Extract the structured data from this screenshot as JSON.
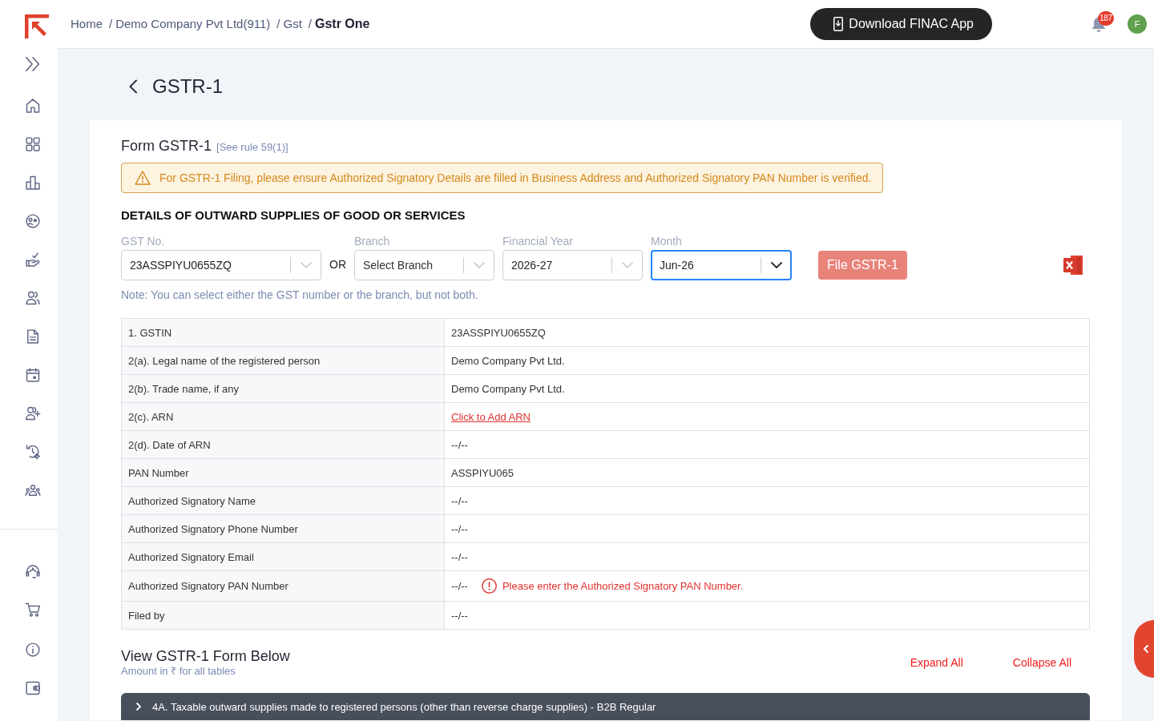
{
  "header": {
    "breadcrumb": [
      {
        "label": "Home",
        "current": false
      },
      {
        "separator": "/",
        "label": "Demo Company Pvt Ltd(911)",
        "current": false
      },
      {
        "separator": "/",
        "label": "Gst",
        "current": false
      },
      {
        "separator": "/",
        "label": "Gstr One",
        "current": true
      }
    ],
    "download_button": "Download FINAC App",
    "notification_count": "187",
    "avatar_initial": "F"
  },
  "page": {
    "title": "GSTR-1"
  },
  "form": {
    "title": "Form GSTR-1",
    "rule": "[See rule 59(1)]",
    "alert": "For GSTR-1 Filing, please ensure Authorized Signatory Details are filled in Business Address and Authorized Signatory PAN Number is verified.",
    "section_heading": "DETAILS OF OUTWARD SUPPLIES OF GOOD OR SERVICES",
    "filters": [
      {
        "kind": "select",
        "label": "GST No.",
        "value": "23ASSPIYU0655ZQ",
        "focused": false
      },
      {
        "kind": "or",
        "text": "OR"
      },
      {
        "kind": "select",
        "label": "Branch",
        "placeholder": "Select Branch",
        "focused": false
      },
      {
        "kind": "select",
        "label": "Financial Year",
        "value": "2026-27",
        "focused": false
      },
      {
        "kind": "select",
        "label": "Month",
        "value": "Jun-26",
        "focused": true
      }
    ],
    "file_button": {
      "label": "File GSTR-1",
      "disabled": true
    },
    "note": "Note: You can select either the GST number or the branch, but not both.",
    "details": [
      {
        "kind": "text",
        "label": "1. GSTIN",
        "value": "23ASSPIYU0655ZQ"
      },
      {
        "kind": "text",
        "label": "2(a). Legal name of the registered person",
        "value": "Demo Company Pvt Ltd."
      },
      {
        "kind": "text",
        "label": "2(b). Trade name, if any",
        "value": "Demo Company Pvt Ltd."
      },
      {
        "kind": "link",
        "label": "2(c). ARN",
        "value": "Click to Add ARN"
      },
      {
        "kind": "text",
        "label": "2(d). Date of ARN",
        "value": "--/--"
      },
      {
        "kind": "text",
        "label": "PAN Number",
        "value": "ASSPIYU065"
      },
      {
        "kind": "text",
        "label": "Authorized Signatory Name",
        "value": "--/--"
      },
      {
        "kind": "text",
        "label": "Authorized Signatory Phone Number",
        "value": "--/--"
      },
      {
        "kind": "text",
        "label": "Authorized Signatory Email",
        "value": "--/--"
      },
      {
        "kind": "text",
        "label": "Authorized Signatory PAN Number",
        "value": "--/--",
        "error": "Please enter the Authorized Signatory PAN Number."
      },
      {
        "kind": "text",
        "label": "Filed by",
        "value": "--/--"
      }
    ]
  },
  "view": {
    "title": "View GSTR-1 Form Below",
    "subtitle": "Amount in ₹ for all tables",
    "actions": [
      "Expand All",
      "Collapse All"
    ],
    "sections": [
      {
        "title": "4A. Taxable outward supplies made to registered persons (other than reverse charge supplies) - B2B Regular",
        "expanded": false
      }
    ]
  }
}
